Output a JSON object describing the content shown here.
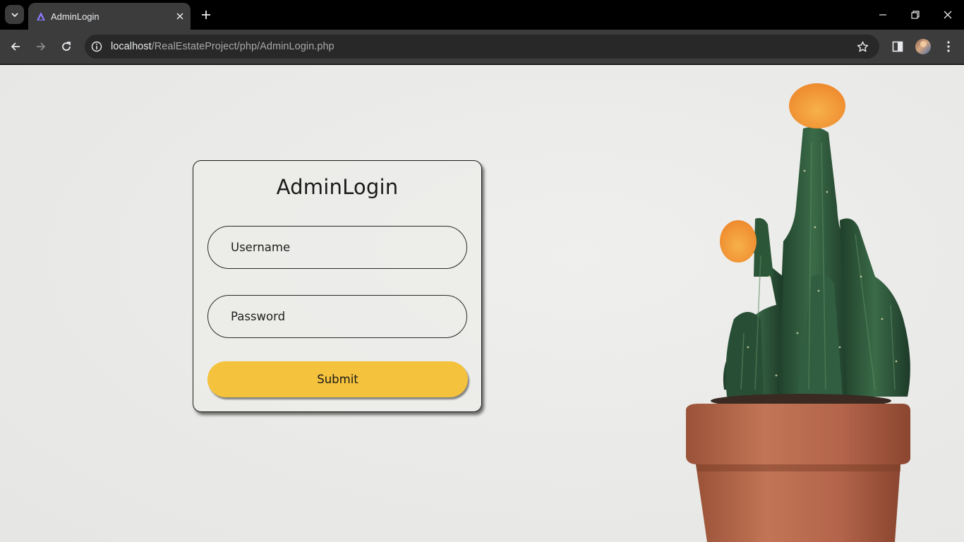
{
  "browser": {
    "tab_title": "AdminLogin",
    "url_host": "localhost",
    "url_path": "/RealEstateProject/php/AdminLogin.php",
    "icons": [
      "tab-search-icon",
      "favicon-icon",
      "close-icon",
      "plus-icon",
      "minimize-icon",
      "restore-icon",
      "window-close-icon",
      "back-icon",
      "forward-icon",
      "reload-icon",
      "info-icon",
      "star-icon",
      "side-panel-icon",
      "avatar",
      "kebab-menu-icon"
    ]
  },
  "login": {
    "title": "AdminLogin",
    "username_placeholder": "Username",
    "password_placeholder": "Password",
    "submit_label": "Submit",
    "accent_color": "#f4c23c"
  },
  "background": {
    "image": "potted cactus with orange flowers",
    "colors": {
      "wall": "#ebebe9",
      "pot": "#b8684a",
      "cactus": "#2f5a3c",
      "flower": "#f29a3a"
    }
  }
}
